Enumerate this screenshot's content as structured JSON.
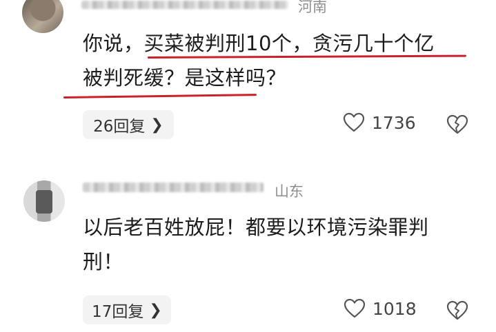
{
  "comments": [
    {
      "location": "河南",
      "text_lines": [
        "你说，买菜被判刑10个，贪污几十个亿",
        "被判死缓？是这样吗？"
      ],
      "reply_label": "26回复",
      "likes": "1736"
    },
    {
      "location": "山东",
      "text_lines": [
        "以后老百姓放屁！都要以环境污染罪判",
        "刑！"
      ],
      "reply_label": "17回复",
      "likes": "1018"
    }
  ],
  "icons": {
    "like": "heart-outline-icon",
    "dislike": "broken-heart-icon",
    "reply_chevron": "chevron-right-icon"
  },
  "colors": {
    "underline": "#c9202a",
    "reply_bg": "#f3f3f3",
    "location": "#8e8e8e"
  }
}
